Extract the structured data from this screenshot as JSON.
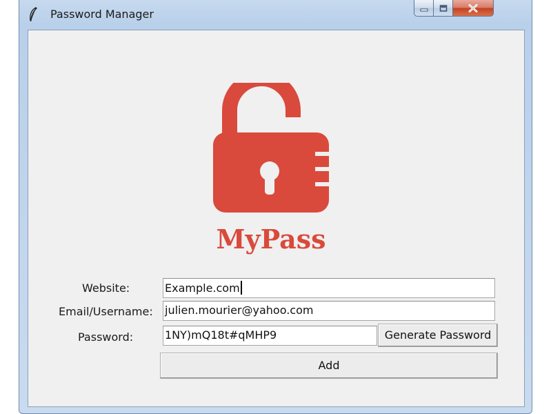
{
  "window": {
    "title": "Password Manager",
    "app_icon": "feather-icon",
    "controls": [
      "minimize-icon",
      "maximize-icon",
      "close-icon"
    ]
  },
  "logo": {
    "icon": "open-padlock-icon",
    "text": "MyPass",
    "color": "#d94a3c"
  },
  "form": {
    "website_label": "Website:",
    "website_value": "Example.com",
    "email_label": "Email/Username:",
    "email_value": "julien.mourier@yahoo.com",
    "password_label": "Password:",
    "password_value": "1NY)mQ18t#qMHP9",
    "generate_button": "Generate Password",
    "add_button": "Add"
  }
}
